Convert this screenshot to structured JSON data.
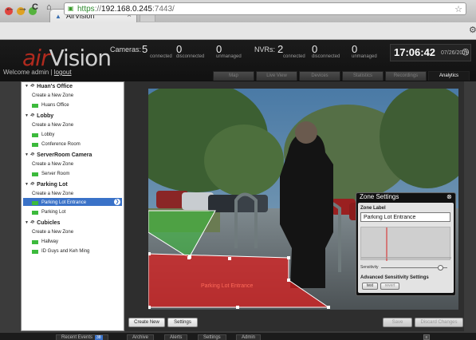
{
  "browser": {
    "tab_title": "AirVision",
    "url_https": "https",
    "url_sep": "://",
    "url_host": "192.168.0.245",
    "url_port": ":7443/"
  },
  "app": {
    "logo_air": "air",
    "logo_vision": "Vision",
    "welcome": "Welcome admin",
    "logout": "logout",
    "cameras_label": "Cameras:",
    "cam_connected": "5",
    "cam_disconnected": "0",
    "cam_unmanaged": "0",
    "nvrs_label": "NVRs:",
    "nvr_connected": "2",
    "nvr_disconnected": "0",
    "nvr_unmanaged": "0",
    "sub_connected": "connected",
    "sub_disconnected": "disconnected",
    "sub_unmanaged": "unmanaged",
    "time": "17:06:42",
    "date": "07/26/2011",
    "tabs": [
      "Map",
      "Live View",
      "Devices",
      "Statistics",
      "Recordings",
      "Analytics"
    ]
  },
  "sidebar": {
    "items": [
      {
        "label": "Huan's Office",
        "type": "group"
      },
      {
        "label": "Create a New Zone",
        "type": "action"
      },
      {
        "label": "Huans Office",
        "type": "zone"
      },
      {
        "label": "Lobby",
        "type": "group"
      },
      {
        "label": "Create a New Zone",
        "type": "action"
      },
      {
        "label": "Lobby",
        "type": "zone"
      },
      {
        "label": "Conference Room",
        "type": "zone"
      },
      {
        "label": "ServerRoom Camera",
        "type": "group"
      },
      {
        "label": "Create a New Zone",
        "type": "action"
      },
      {
        "label": "Server Room",
        "type": "zone"
      },
      {
        "label": "Parking Lot",
        "type": "group"
      },
      {
        "label": "Create a New Zone",
        "type": "action"
      },
      {
        "label": "Parking Lot Entrance",
        "type": "zone",
        "selected": true
      },
      {
        "label": "Parking Lot",
        "type": "zone"
      },
      {
        "label": "Cubicles",
        "type": "group"
      },
      {
        "label": "Create a New Zone",
        "type": "action"
      },
      {
        "label": "Hallway",
        "type": "zone"
      },
      {
        "label": "ID Guys and Keh Ming",
        "type": "zone"
      }
    ]
  },
  "main": {
    "zone_overlay_label": "Parking Lot Entrance",
    "create_new": "Create New",
    "settings": "Settings",
    "save": "Save",
    "discard": "Discard Changes"
  },
  "zone_settings": {
    "title": "Zone Settings",
    "zone_label_heading": "Zone Label",
    "zone_label_value": "Parking Lot Entrance",
    "sensitivity": "Sensitivity",
    "sensitivity_level": 0.9,
    "advanced": "Advanced Sensitivity Settings",
    "test": "test",
    "revert": "revert"
  },
  "bottom": {
    "tabs": [
      {
        "label": "Recent Events",
        "badge": "38"
      },
      {
        "label": "Archive"
      },
      {
        "label": "Alerts"
      },
      {
        "label": "Settings"
      },
      {
        "label": "Admin"
      }
    ]
  },
  "colors": {
    "accent": "#3a72c8",
    "brand_red": "#b02a1e",
    "zone_red": "#d92020",
    "zone_green": "#3cba3c"
  }
}
